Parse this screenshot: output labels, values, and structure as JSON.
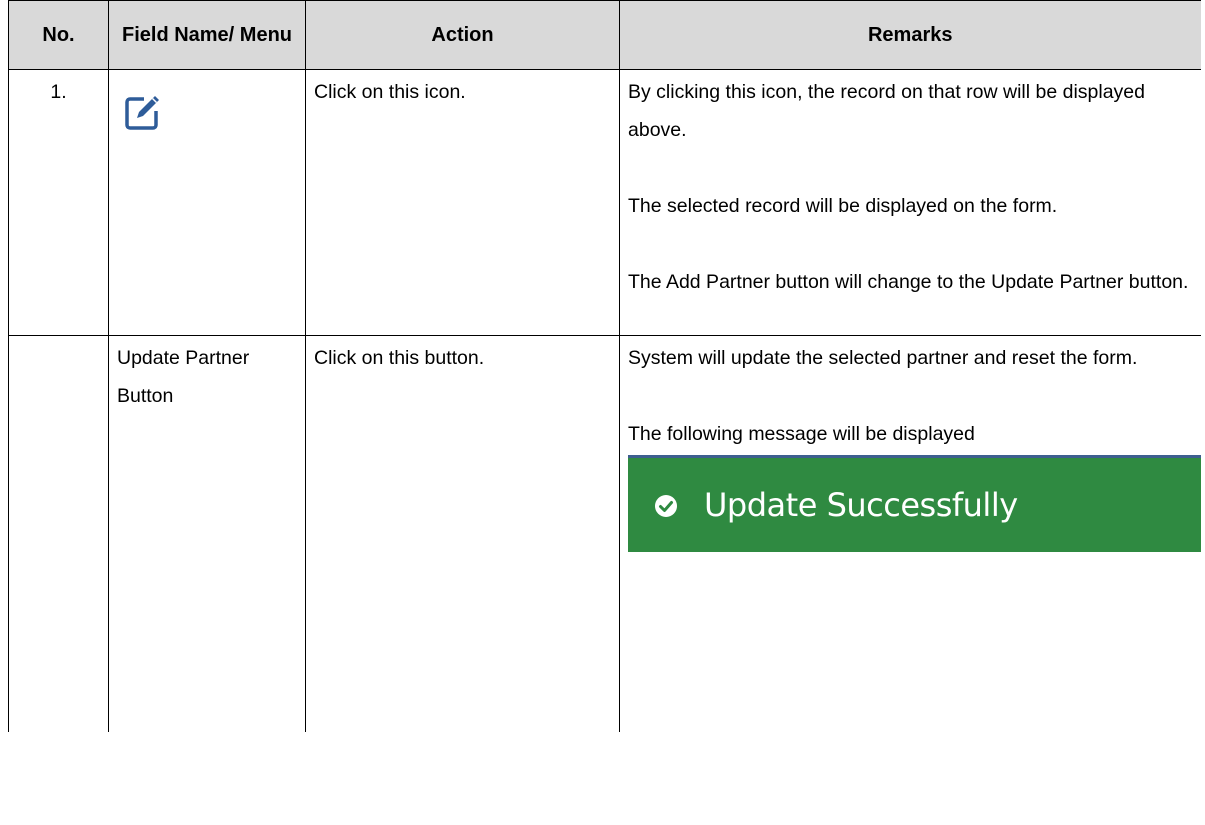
{
  "table": {
    "headers": [
      "No.",
      "Field Name/ Menu",
      "Action",
      "Remarks"
    ],
    "rows": [
      {
        "no": "1.",
        "field_icon": "edit-icon",
        "action": "Click on this icon.",
        "remarks": [
          "By clicking this icon, the record on that row will be displayed above.",
          "The selected record will be displayed on the form.",
          "The Add Partner button will change to the Update Partner button."
        ]
      },
      {
        "no": "",
        "field": "Update Partner Button",
        "action": "Click on this button.",
        "remarks": [
          "System will update the selected partner and reset the form.",
          "The following message will be displayed"
        ],
        "toast": {
          "icon": "check-circle-icon",
          "text": "Update Successfully",
          "background": "#2f8a41"
        }
      }
    ]
  },
  "colors": {
    "header_bg": "#d9d9d9",
    "icon": "#2e5c99",
    "toast_bg": "#2f8a41"
  }
}
